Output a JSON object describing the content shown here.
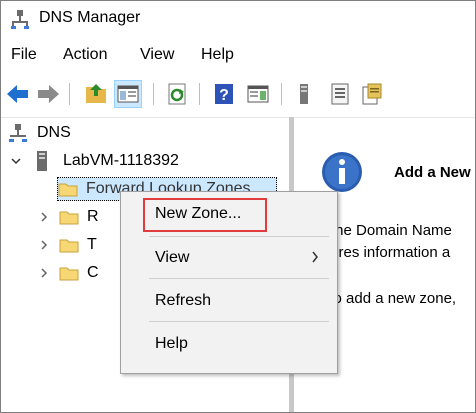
{
  "window": {
    "title": "DNS Manager"
  },
  "menubar": {
    "items": [
      "File",
      "Action",
      "View",
      "Help"
    ]
  },
  "tree": {
    "root": "DNS",
    "server": "LabVM-1118392",
    "children": [
      "Forward Lookup Zones",
      "R",
      "T",
      "C"
    ]
  },
  "right_pane": {
    "heading": "Add a New",
    "lines": [
      "The Domain Name",
      "tores information a",
      "To add a new zone,"
    ]
  },
  "context_menu": {
    "items": [
      "New Zone...",
      "View",
      "Refresh",
      "Help"
    ]
  },
  "colors": {
    "selection": "#cce8ff",
    "highlight_border": "#e03c3c",
    "arrow_blue": "#1f6fd1"
  }
}
